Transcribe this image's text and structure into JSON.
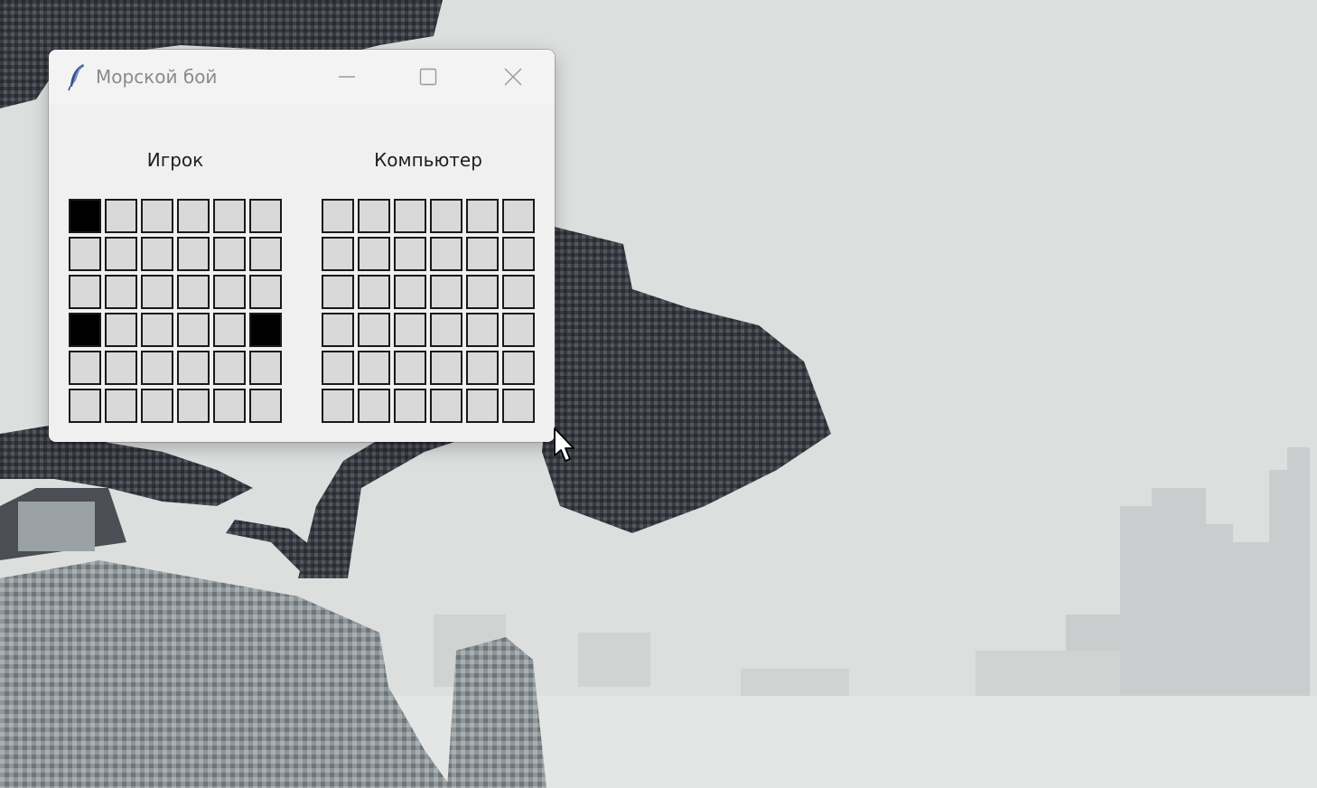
{
  "window": {
    "title": "Морской бой",
    "icon": "feather-icon",
    "buttons": {
      "minimize": "minimize-icon",
      "maximize": "maximize-icon",
      "close": "close-icon"
    }
  },
  "boards": {
    "player_label": "Игрок",
    "computer_label": "Компьютер",
    "rows": 6,
    "cols": 6,
    "player_ships": [
      [
        0,
        0
      ],
      [
        3,
        0
      ],
      [
        3,
        5
      ]
    ],
    "computer_ships": []
  },
  "colors": {
    "cell_empty": "#d9d9d9",
    "cell_ship": "#000000",
    "cell_border": "#1a1a1a"
  }
}
